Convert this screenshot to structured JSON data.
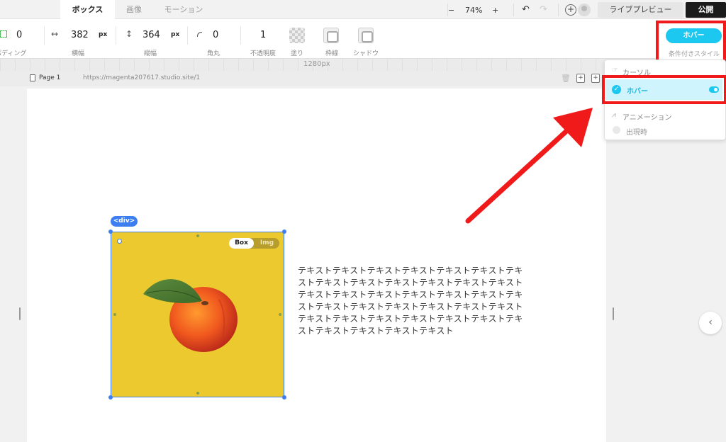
{
  "tabs": [
    {
      "label": "ボックス",
      "active": true
    },
    {
      "label": "画像",
      "active": false
    },
    {
      "label": "モーション",
      "active": false
    }
  ],
  "zoom": {
    "minus": "−",
    "value": "74%",
    "plus": "+"
  },
  "history": {
    "undo": "↶",
    "redo": "↷"
  },
  "header": {
    "preview_label": "ライブプレビュー",
    "publish_label": "公開"
  },
  "properties": {
    "padding": {
      "value": "0",
      "label": "パディング"
    },
    "width": {
      "value": "382",
      "unit": "px",
      "label": "横幅"
    },
    "height": {
      "value": "364",
      "unit": "px",
      "label": "縦幅"
    },
    "radius": {
      "value": "0",
      "label": "角丸"
    },
    "opacity": {
      "value": "1",
      "label": "不透明度"
    },
    "fill": {
      "label": "塗り"
    },
    "border": {
      "label": "枠線"
    },
    "shadow": {
      "label": "シャドウ"
    }
  },
  "condition": {
    "button_label": "ホバー",
    "sub_label": "条件付きスタイル"
  },
  "ruler": {
    "label": "1280px"
  },
  "page": {
    "name": "Page 1",
    "url": "https://magenta207617.studio.site/1"
  },
  "element": {
    "tag_label": "<div>",
    "toggle_on": "Box",
    "toggle_off": "Img"
  },
  "body_text": "テキストテキストテキストテキストテキストテキストテキストテキストテキストテキストテキストテキストテキストテキストテキストテキストテキストテキストテキストテキストテキストテキストテキストテキストテキストテキストテキストテキストテキストテキストテキストテキストテキストテキストテキストテキストテキスト",
  "dropdown": {
    "items": [
      {
        "label": "カーソル",
        "icon": "cursor-icon"
      },
      {
        "label": "ホバー",
        "icon": "check-icon",
        "selected": true
      },
      {
        "label": "アニメーション",
        "icon": "animation-icon"
      },
      {
        "label": "出現時",
        "icon": "circle-icon"
      }
    ]
  },
  "colors": {
    "accent": "#1cc7f0",
    "selection": "#3d7ff0",
    "highlight": "#f01a1a",
    "box_fill": "#ecc92f"
  }
}
